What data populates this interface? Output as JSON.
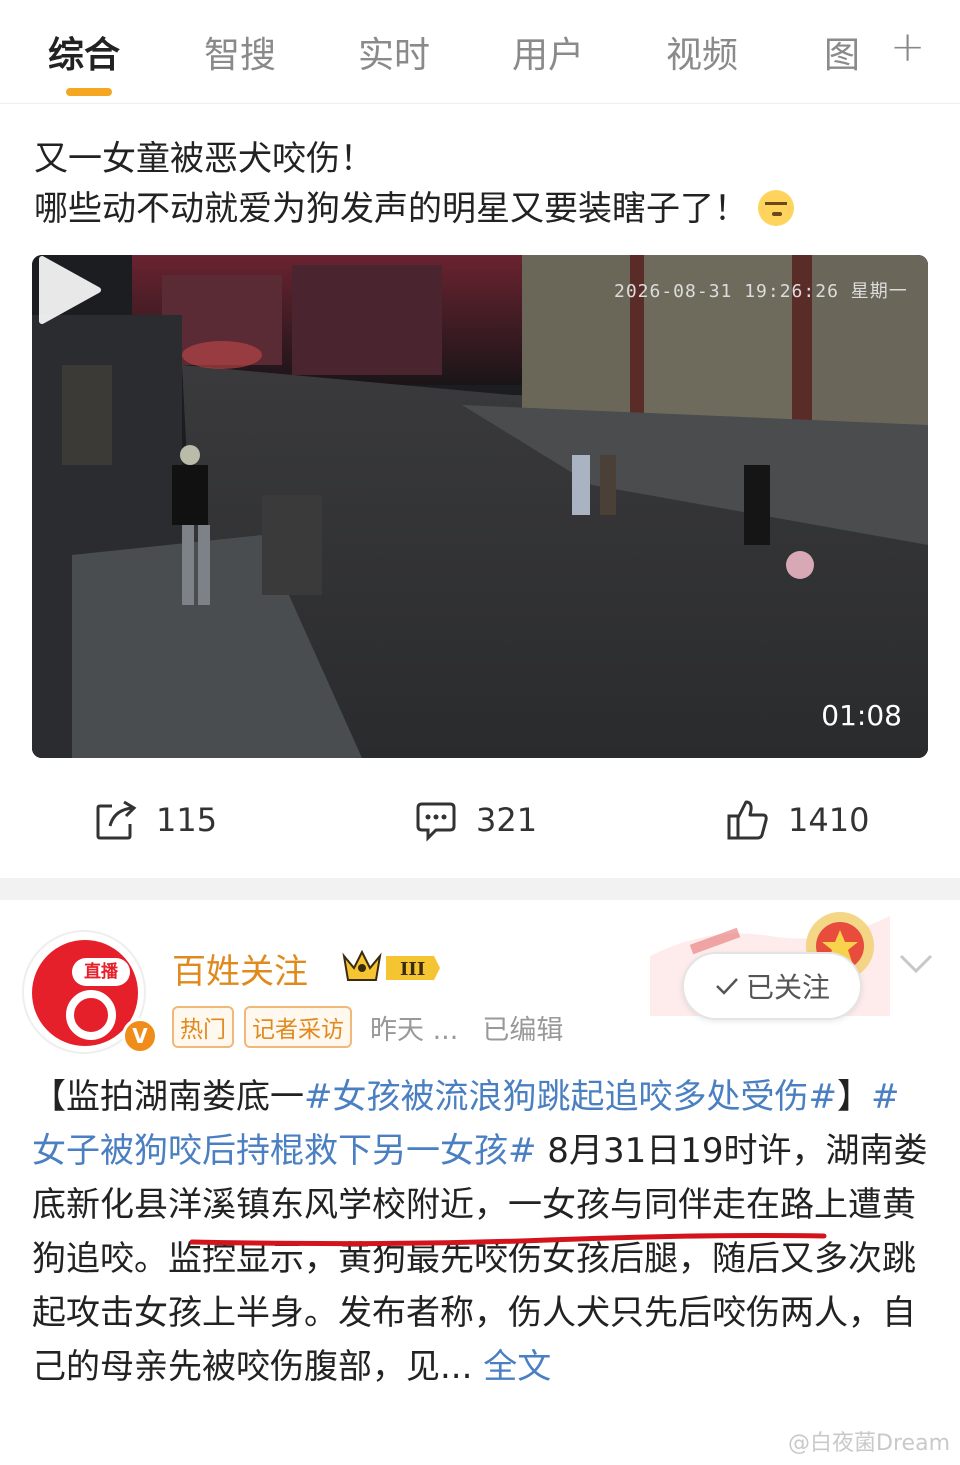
{
  "tabs": [
    {
      "label": "综合",
      "active": true
    },
    {
      "label": "智搜",
      "active": false
    },
    {
      "label": "实时",
      "active": false
    },
    {
      "label": "用户",
      "active": false
    },
    {
      "label": "视频",
      "active": false
    },
    {
      "label": "图",
      "active": false
    }
  ],
  "tab_more": "+",
  "post1": {
    "line1": "又一女童被恶犬咬伤！",
    "line2": "哪些动不动就爱为狗发声的明星又要装瞎子了！",
    "video": {
      "timestamp": "2026-08-31 19:26:26 星期一",
      "duration": "01:08"
    },
    "actions": {
      "repost": "115",
      "comment": "321",
      "like": "1410"
    }
  },
  "post2": {
    "username": "百姓关注",
    "level_badge": "III",
    "avatar_label": "直播",
    "verified": "V",
    "tags": [
      "热门",
      "记者采访"
    ],
    "time": "昨天 ...",
    "edited": "已编辑",
    "follow_label": "已关注",
    "body": {
      "p1": "【监拍湖南娄底一",
      "h1": "#女孩被流浪狗跳起追咬多处受伤#",
      "p2": "】",
      "h2": "#女子被狗咬后持棍救下另一女孩#",
      "p3": " 8月31日19时许，",
      "p4": "湖南娄底新化县洋溪镇东风学校附近",
      "p5": "，一女孩与同伴走在路上遭黄狗追咬。监控显示，黄狗最先咬伤女孩后腿，随后又多次跳起攻击女孩上半身。发布者称，伤人犬只先后咬伤两人，自己的母亲先被咬伤腹部，见...",
      "more": " 全文"
    }
  },
  "watermark": "@白夜菌Dream",
  "colors": {
    "accent": "#f5a623",
    "username": "#e08a1e",
    "link": "#4a7fc1",
    "live_red": "#e6202a"
  }
}
